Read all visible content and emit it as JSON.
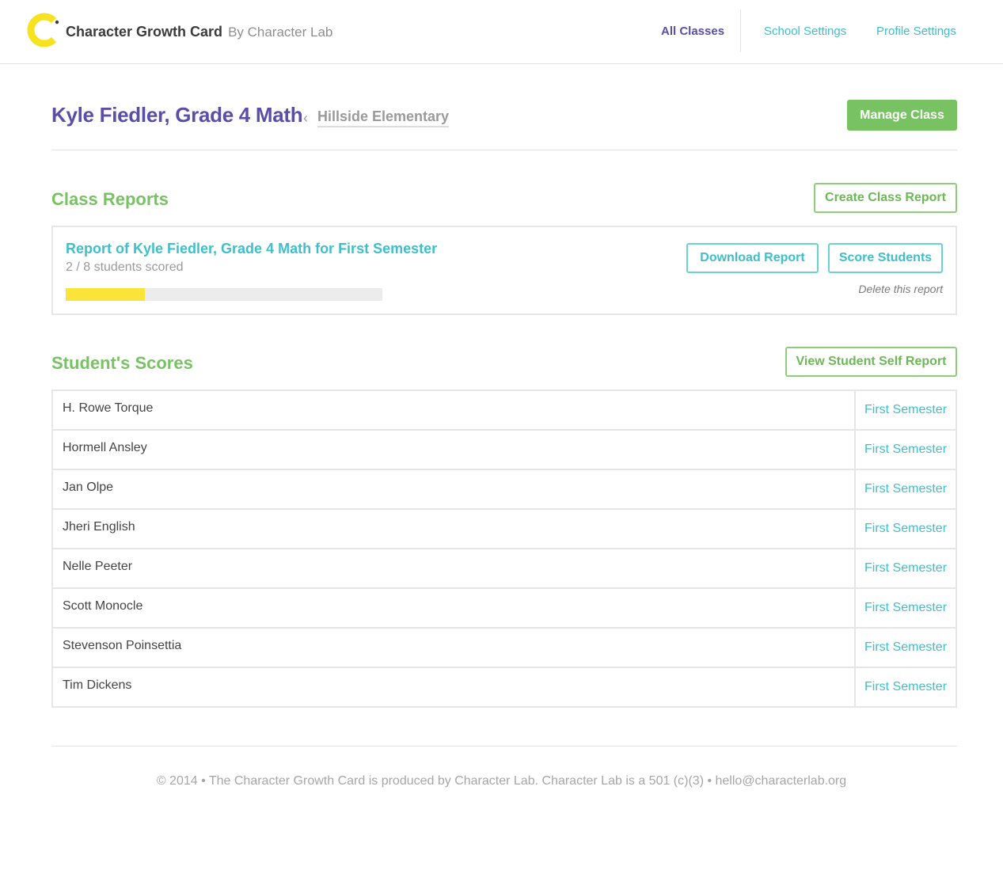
{
  "header": {
    "logo_icon": "character-lab-c-logo-icon",
    "app_name": "Character Growth Card",
    "by_line": "By Character Lab",
    "nav": [
      {
        "label": "All Classes",
        "active": true
      },
      {
        "label": "School Settings",
        "active": false
      },
      {
        "label": "Profile Settings",
        "active": false
      }
    ]
  },
  "page": {
    "title": "Kyle Fiedler, Grade 4 Math",
    "breadcrumb_chevron": "‹",
    "school": "Hillside Elementary",
    "manage_button": "Manage Class"
  },
  "class_reports": {
    "title": "Class Reports",
    "create_button": "Create Class Report",
    "report": {
      "title": "Report of Kyle Fiedler, Grade 4 Math for First Semester",
      "scored_text": "2 / 8 students scored",
      "progress": 0.25,
      "download_button": "Download Report",
      "score_button": "Score Students",
      "delete_link": "Delete this report"
    }
  },
  "students_section": {
    "title": "Student's Scores",
    "self_report_button": "View Student Self Report",
    "students": [
      {
        "name": "H. Rowe Torque",
        "semester": "First Semester"
      },
      {
        "name": "Hormell Ansley",
        "semester": "First Semester"
      },
      {
        "name": "Jan Olpe",
        "semester": "First Semester"
      },
      {
        "name": "Jheri English",
        "semester": "First Semester"
      },
      {
        "name": "Nelle Peeter",
        "semester": "First Semester"
      },
      {
        "name": "Scott Monocle",
        "semester": "First Semester"
      },
      {
        "name": "Stevenson Poinsettia",
        "semester": "First Semester"
      },
      {
        "name": "Tim Dickens",
        "semester": "First Semester"
      }
    ]
  },
  "footer": {
    "text": "© 2014 • The Character Growth Card is produced by Character Lab. Character Lab is a 501 (c)(3) • hello@characterlab.org"
  },
  "colors": {
    "brand_purple": "#5a4ea8",
    "accent_green": "#79c263",
    "accent_teal": "#3fbfc9",
    "progress_yellow": "#fbe43a"
  }
}
